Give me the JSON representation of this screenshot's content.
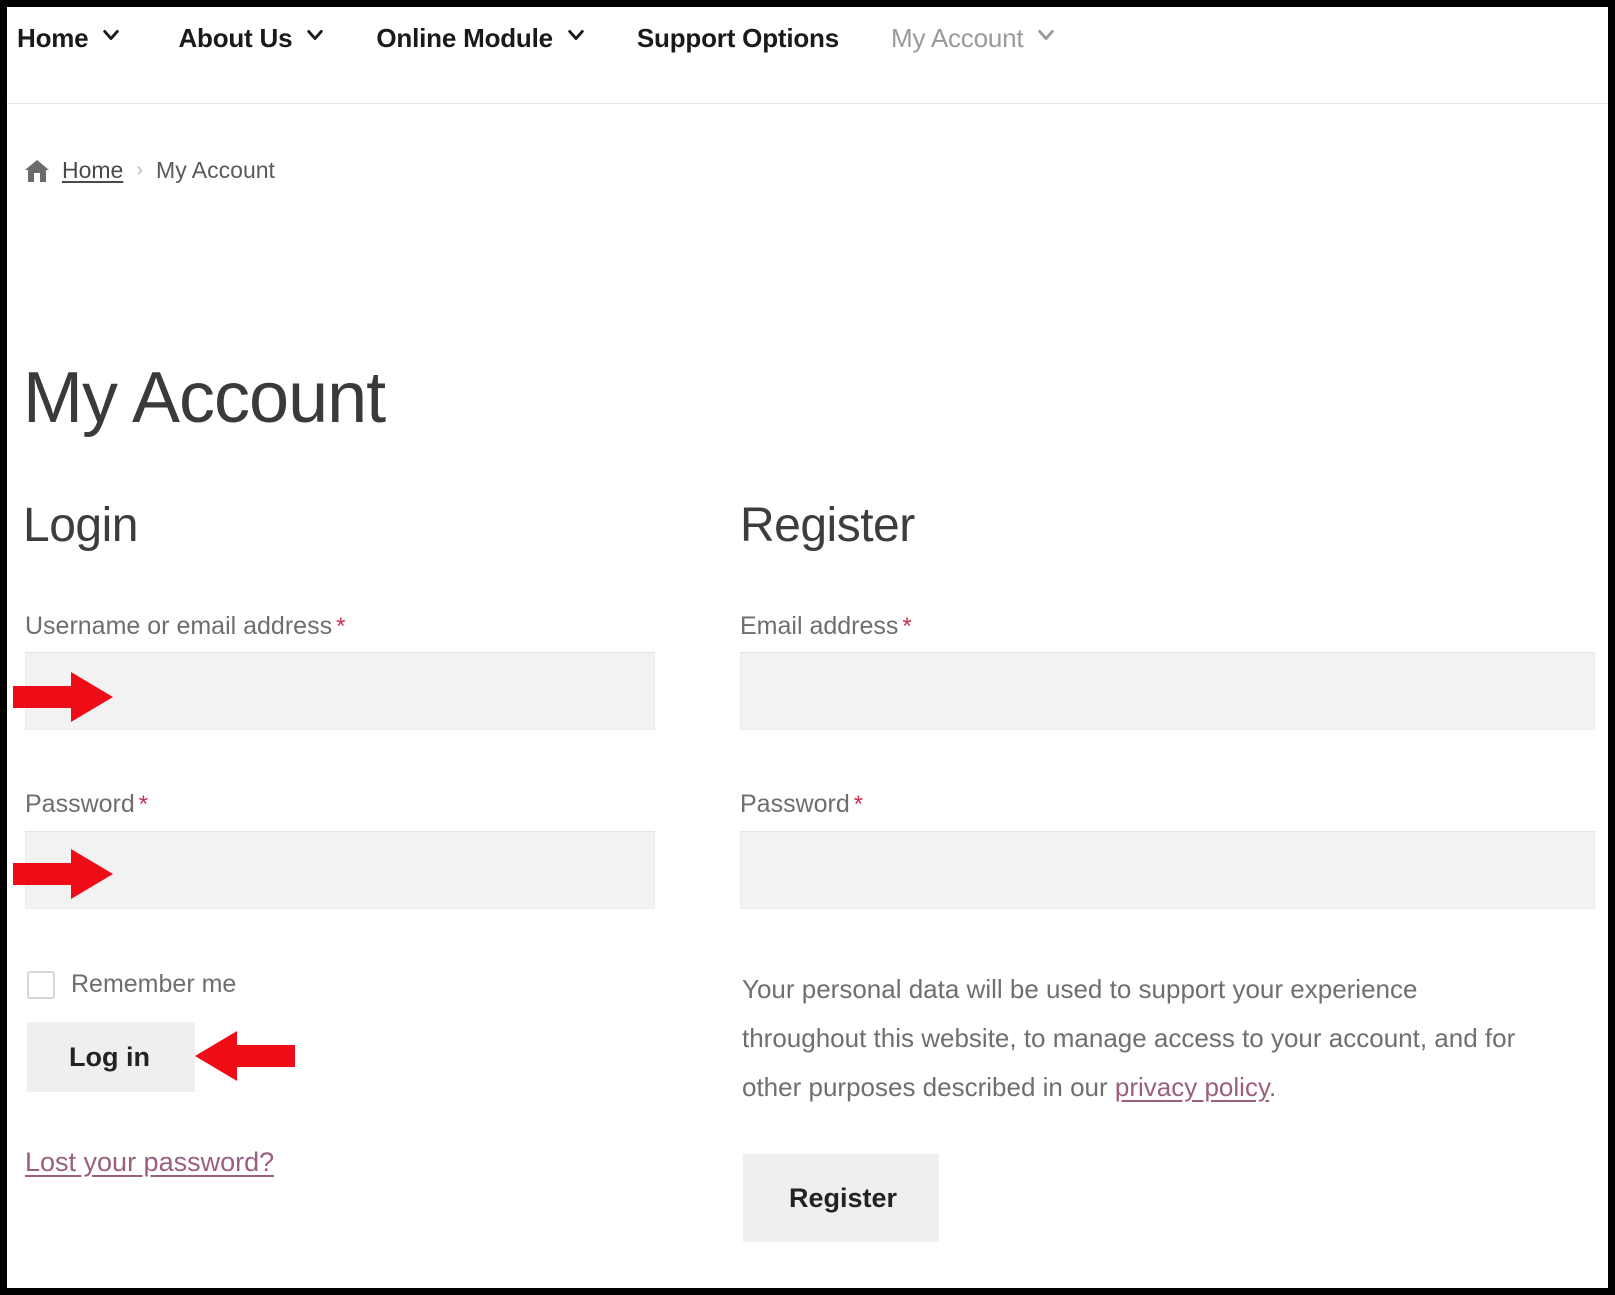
{
  "nav": {
    "items": [
      {
        "label": "Home",
        "has_caret": true,
        "muted": false
      },
      {
        "label": "About Us",
        "has_caret": true,
        "muted": false
      },
      {
        "label": "Online Module",
        "has_caret": true,
        "muted": false
      },
      {
        "label": "Support Options",
        "has_caret": false,
        "muted": false
      },
      {
        "label": "My Account",
        "has_caret": true,
        "muted": true
      }
    ]
  },
  "breadcrumb": {
    "home_icon": "home-icon",
    "home_label": "Home",
    "separator": "›",
    "current": "My Account"
  },
  "page": {
    "title": "My Account"
  },
  "login": {
    "heading": "Login",
    "username_label": "Username or email address",
    "username_required": "*",
    "username_value": "",
    "username_placeholder": "",
    "password_label": "Password",
    "password_required": "*",
    "password_value": "",
    "password_placeholder": "",
    "remember_label": "Remember me",
    "remember_checked": false,
    "submit_label": "Log in",
    "lost_password_label": "Lost your password?"
  },
  "register": {
    "heading": "Register",
    "email_label": "Email address",
    "email_required": "*",
    "email_value": "",
    "email_placeholder": "",
    "password_label": "Password",
    "password_required": "*",
    "password_value": "",
    "password_placeholder": "",
    "privacy_text_before": "Your personal data will be used to support your experience throughout this website, to manage access to your account, and for other purposes described in our ",
    "privacy_link_label": "privacy policy",
    "privacy_text_after": ".",
    "submit_label": "Register"
  },
  "annotations": {
    "arrow_color": "#ee0d16",
    "arrows": [
      {
        "name": "arrow-username",
        "direction": "right"
      },
      {
        "name": "arrow-password",
        "direction": "right"
      },
      {
        "name": "arrow-login",
        "direction": "left"
      }
    ]
  },
  "colors": {
    "required_asterisk": "#c8304f",
    "link_purple": "#9a5f7e",
    "input_background": "#f2f2f2",
    "button_background": "#efefef",
    "page_background": "#ffffff",
    "border": "#000000"
  }
}
